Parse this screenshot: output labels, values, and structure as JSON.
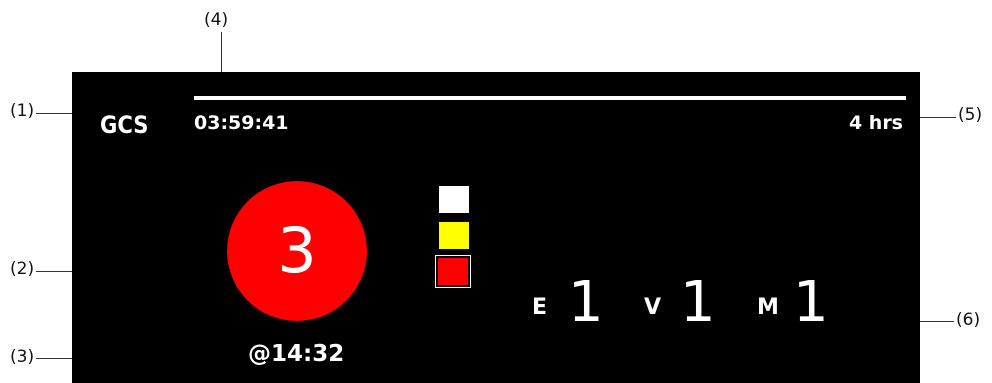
{
  "callouts": {
    "c1": "(1)",
    "c2": "(2)",
    "c3": "(3)",
    "c4": "(4)",
    "c5": "(5)",
    "c6": "(6)"
  },
  "tile": {
    "label": "GCS",
    "elapsed": "03:59:41",
    "interval": "4 hrs",
    "progress": 1.0,
    "score": "3",
    "score_color": "#ff0000",
    "timestamp": "@14:32",
    "level_colors": [
      "#ffffff",
      "#ffff00",
      "#ff0000"
    ],
    "selected_level": "red",
    "components": {
      "e_label": "E",
      "e_value": "1",
      "v_label": "V",
      "v_value": "1",
      "m_label": "M",
      "m_value": "1"
    }
  }
}
